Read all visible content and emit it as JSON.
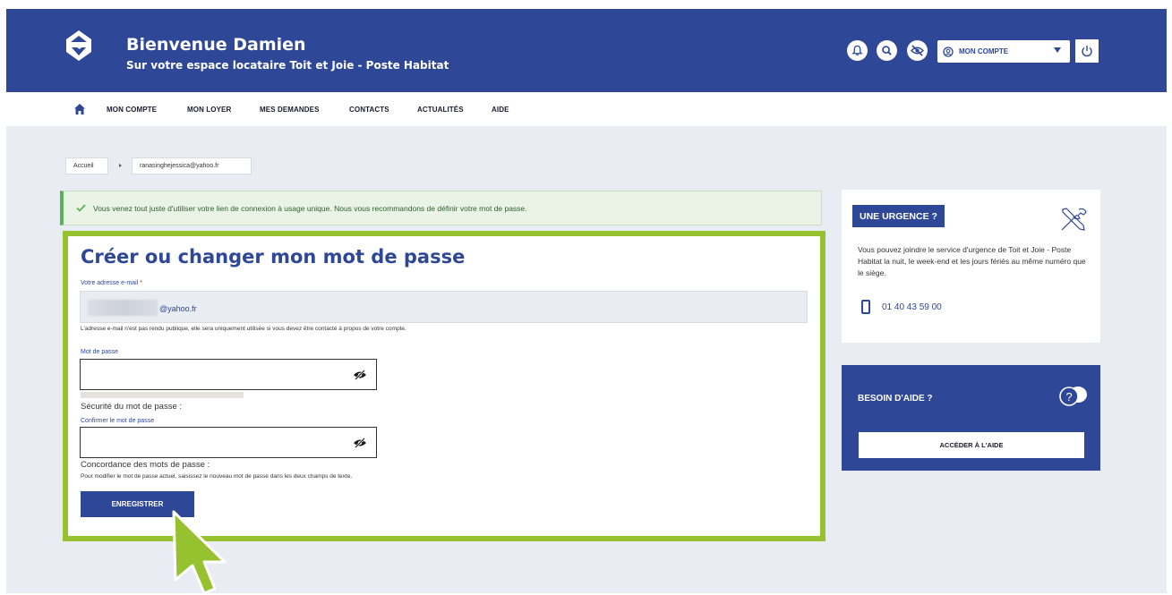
{
  "header": {
    "title": "Bienvenue Damien",
    "subtitle": "Sur votre espace locataire Toit et Joie - Poste Habitat",
    "account_label": "MON COMPTE"
  },
  "nav": {
    "items": [
      {
        "label": "MON COMPTE"
      },
      {
        "label": "MON LOYER"
      },
      {
        "label": "MES DEMANDES"
      },
      {
        "label": "CONTACTS"
      },
      {
        "label": "ACTUALITÉS"
      },
      {
        "label": "AIDE"
      }
    ]
  },
  "breadcrumb": {
    "home": "Accueil",
    "current": "ranasinghejessica@yahoo.fr"
  },
  "alert": {
    "message": "Vous venez tout juste d'utiliser votre lien de connexion à usage unique. Nous vous recommandons de définir votre mot de passe."
  },
  "form": {
    "title": "Créer ou changer mon mot de passe",
    "email_label": "Votre adresse e-mail",
    "email_required_mark": "*",
    "email_value": "@yahoo.fr",
    "email_help": "L'adresse e-mail n'est pas rendu publique, elle sera uniquement utilisée si vous devez être contacté à propos de votre compte.",
    "password_label": "Mot de passe",
    "password_strength_label": "Sécurité du mot de passe :",
    "confirm_label": "Confirmer le mot de passe",
    "match_label": "Concordance des mots de passe :",
    "password_help": "Pour modifier le mot de passe actuel, saisissez le nouveau mot de passe dans les deux champs de texte.",
    "save_label": "ENREGISTRER"
  },
  "urgency": {
    "title": "UNE URGENCE ?",
    "text": "Vous pouvez joindre le service d'urgence de Toit et Joie - Poste Habitat la nuit, le week-end et les jours fériés au même numéro que le siège.",
    "phone": "01 40 43 59 00"
  },
  "help": {
    "title": "BESOIN D'AIDE ?",
    "button_label": "ACCÉDER À L'AIDE"
  },
  "colors": {
    "brand": "#2f4797",
    "highlight": "#97c230",
    "success": "#5bb05b"
  }
}
